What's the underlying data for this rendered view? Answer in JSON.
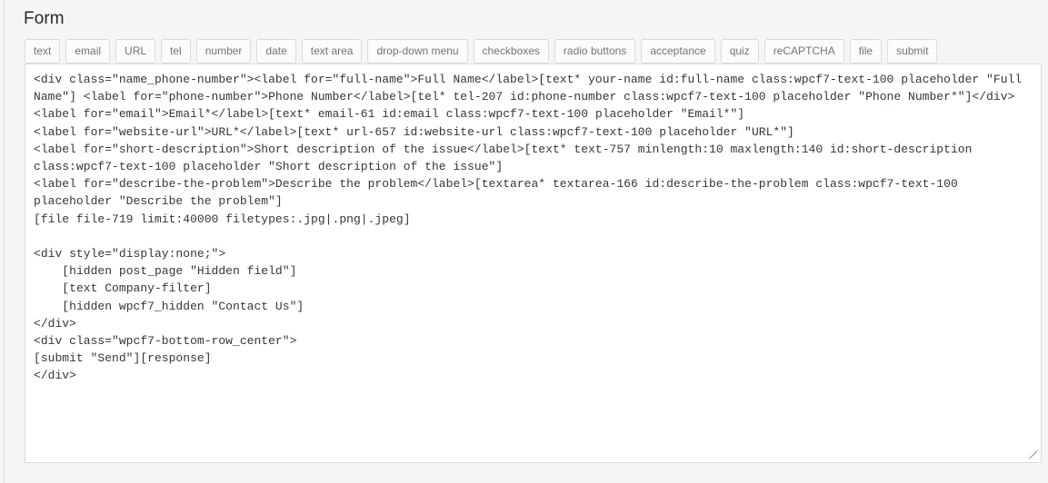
{
  "page": {
    "title": "Form"
  },
  "tag_toolbar": {
    "buttons": [
      {
        "label": "text"
      },
      {
        "label": "email"
      },
      {
        "label": "URL"
      },
      {
        "label": "tel"
      },
      {
        "label": "number"
      },
      {
        "label": "date"
      },
      {
        "label": "text area"
      },
      {
        "label": "drop-down menu"
      },
      {
        "label": "checkboxes"
      },
      {
        "label": "radio buttons"
      },
      {
        "label": "acceptance"
      },
      {
        "label": "quiz"
      },
      {
        "label": "reCAPTCHA"
      },
      {
        "label": "file"
      },
      {
        "label": "submit"
      }
    ]
  },
  "form_editor": {
    "code": "<div class=\"name_phone-number\"><label for=\"full-name\">Full Name</label>[text* your-name id:full-name class:wpcf7-text-100 placeholder \"Full Name\"] <label for=\"phone-number\">Phone Number</label>[tel* tel-207 id:phone-number class:wpcf7-text-100 placeholder \"Phone Number*\"]</div>\n<label for=\"email\">Email*</label>[text* email-61 id:email class:wpcf7-text-100 placeholder \"Email*\"]\n<label for=\"website-url\">URL*</label>[text* url-657 id:website-url class:wpcf7-text-100 placeholder \"URL*\"]\n<label for=\"short-description\">Short description of the issue</label>[text* text-757 minlength:10 maxlength:140 id:short-description class:wpcf7-text-100 placeholder \"Short description of the issue\"]\n<label for=\"describe-the-problem\">Describe the problem</label>[textarea* textarea-166 id:describe-the-problem class:wpcf7-text-100 placeholder \"Describe the problem\"]\n[file file-719 limit:40000 filetypes:.jpg|.png|.jpeg]\n\n<div style=\"display:none;\">\n    [hidden post_page \"Hidden field\"]\n    [text Company-filter]\n    [hidden wpcf7_hidden \"Contact Us\"]\n</div>\n<div class=\"wpcf7-bottom-row_center\">\n[submit \"Send\"][response]\n</div>",
    "colors": {
      "page_background": "#f1f1f1",
      "panel_background": "#f5f5f5",
      "editor_background": "#ffffff",
      "editor_border": "#dcdcdc",
      "text": "#32373c",
      "title_text": "#23282d",
      "button_text": "#70767b"
    }
  }
}
